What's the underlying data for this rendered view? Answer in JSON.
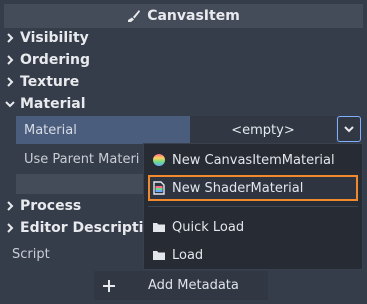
{
  "inspector": {
    "header_title": "CanvasItem",
    "sections": {
      "visibility": "Visibility",
      "ordering": "Ordering",
      "texture": "Texture",
      "material": "Material",
      "process": "Process",
      "editor_description": "Editor Description"
    },
    "material_property": {
      "label": "Material",
      "value": "<empty>"
    },
    "use_parent_label": "Use Parent Materi",
    "script_label": "Script",
    "add_metadata_label": "Add Metadata"
  },
  "popup_menu": {
    "items": [
      {
        "label": "New CanvasItemMaterial",
        "icon": "canvasitemmaterial-icon"
      },
      {
        "label": "New ShaderMaterial",
        "icon": "shadermaterial-icon",
        "highlighted": true
      },
      {
        "label": "Quick Load",
        "icon": "folder-icon"
      },
      {
        "label": "Load",
        "icon": "folder-icon"
      }
    ]
  },
  "colors": {
    "background": "#363d4a",
    "header": "#454c59",
    "selected_label": "#4b5d7c",
    "highlight_outline": "#f08a2c",
    "dropdown_border": "#7fb0ff"
  }
}
